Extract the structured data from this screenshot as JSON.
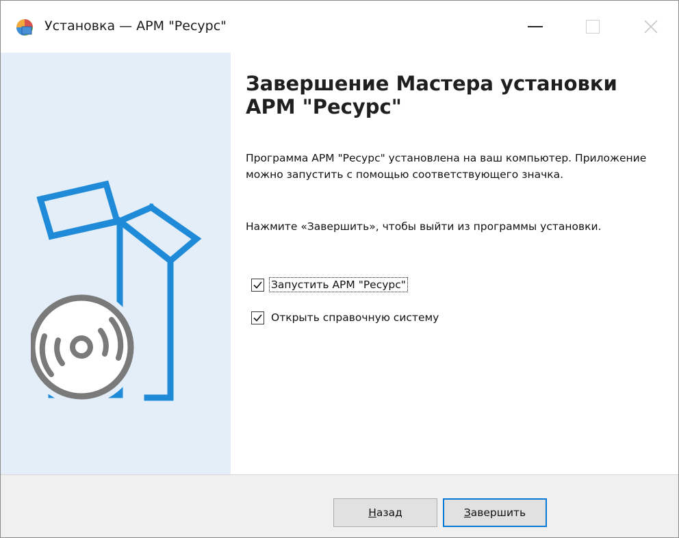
{
  "window": {
    "title": "Установка — АРМ \"Ресурс\""
  },
  "main": {
    "heading": "Завершение Мастера установки АРМ \"Ресурс\"",
    "paragraph1": "Программа АРМ \"Ресурс\" установлена на ваш компьютер. Приложение можно запустить с помощью соответствующего значка.",
    "paragraph2": "Нажмите «Завершить», чтобы выйти из программы установки.",
    "checkboxes": [
      {
        "label": "Запустить АРМ \"Ресурс\"",
        "checked": true
      },
      {
        "label": "Открыть справочную систему",
        "checked": true
      }
    ]
  },
  "buttons": {
    "back_mnemonic": "Н",
    "back_rest": "азад",
    "finish_mnemonic": "З",
    "finish_rest": "авершить"
  },
  "colors": {
    "accent": "#0078d7",
    "panel": "#e3eef8",
    "art_blue": "#1f8ad8",
    "art_gray": "#7a7a7a"
  },
  "icons": {
    "app": "installer-icon",
    "minimize": "minimize-icon",
    "maximize": "maximize-icon",
    "close": "close-icon",
    "art": "box-with-disc-icon"
  }
}
